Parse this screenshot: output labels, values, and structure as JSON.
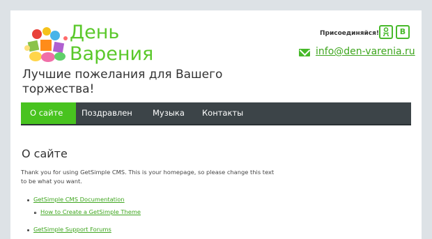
{
  "header": {
    "title_line1": "День",
    "title_line2": "Варения",
    "tagline": "Лучшие пожелания для Вашего торжества!",
    "join_label": "Присоединяйся!",
    "social_ok_glyph": "ОК",
    "social_vk_glyph": "В",
    "email": "info@den-varenia.ru"
  },
  "nav": {
    "items": [
      {
        "label": "О сайте"
      },
      {
        "label": "Поздравлен"
      },
      {
        "label": "Музыка"
      },
      {
        "label": "Контакты"
      }
    ]
  },
  "main": {
    "heading": "О сайте",
    "paragraph": "Thank you for using GetSimple CMS. This is your homepage, so please change this text to be what you want.",
    "links": [
      {
        "label": "GetSimple CMS Documentation"
      },
      {
        "label": "How to Create a GetSimple Theme"
      },
      {
        "label": "GetSimple Support Forums"
      }
    ]
  },
  "colors": {
    "accent": "#48c31f",
    "nav_bg": "#3c4448",
    "page_bg": "#dde2e6"
  }
}
